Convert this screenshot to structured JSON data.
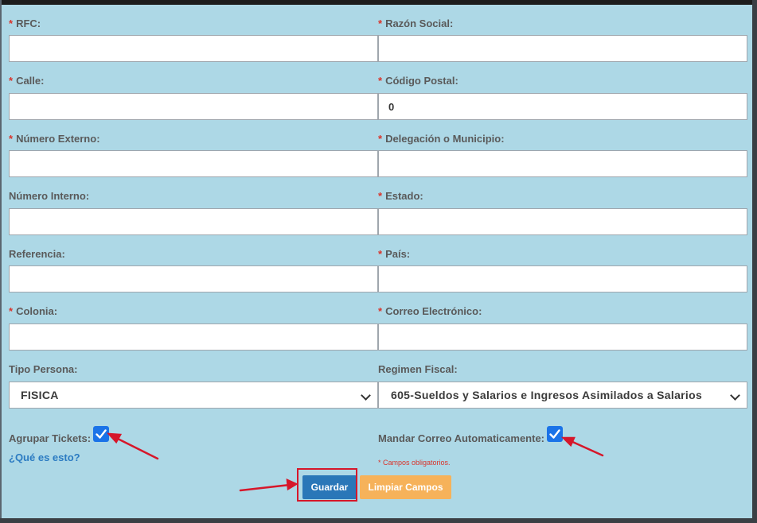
{
  "form": {
    "required_marker": "*",
    "fields": [
      {
        "id": "rfc",
        "label": "RFC:",
        "required": true,
        "value": ""
      },
      {
        "id": "razon_social",
        "label": "Razón Social:",
        "required": true,
        "value": ""
      },
      {
        "id": "calle",
        "label": "Calle:",
        "required": true,
        "value": ""
      },
      {
        "id": "codigo_postal",
        "label": "Código Postal:",
        "required": true,
        "value": "0"
      },
      {
        "id": "numero_externo",
        "label": "Número Externo:",
        "required": true,
        "value": ""
      },
      {
        "id": "delegacion",
        "label": "Delegación o Municipio:",
        "required": true,
        "value": ""
      },
      {
        "id": "numero_interno",
        "label": "Número Interno:",
        "required": false,
        "value": ""
      },
      {
        "id": "estado",
        "label": "Estado:",
        "required": true,
        "value": ""
      },
      {
        "id": "referencia",
        "label": "Referencia:",
        "required": false,
        "value": ""
      },
      {
        "id": "pais",
        "label": "País:",
        "required": true,
        "value": ""
      },
      {
        "id": "colonia",
        "label": "Colonia:",
        "required": true,
        "value": ""
      },
      {
        "id": "correo",
        "label": "Correo Electrónico:",
        "required": true,
        "value": ""
      }
    ],
    "tipo_persona": {
      "label": "Tipo Persona:",
      "value": "FISICA"
    },
    "regimen_fiscal": {
      "label": "Regimen Fiscal:",
      "value": "605-Sueldos y Salarios e Ingresos Asimilados a Salarios"
    },
    "agrupar_tickets": {
      "label": "Agrupar Tickets:",
      "checked": true
    },
    "help_link": "¿Qué es esto?",
    "mandar_correo": {
      "label": "Mandar Correo Automaticamente:",
      "checked": true
    },
    "required_note": "* Campos obligatorios.",
    "save_button": "Guardar",
    "clear_button": "Limpiar Campos"
  },
  "colors": {
    "background": "#add8e6",
    "required": "#d9342b",
    "save_button": "#2a77b8",
    "clear_button": "#f6b25a",
    "checkbox": "#1a73e8",
    "annotation": "#d6172a"
  }
}
